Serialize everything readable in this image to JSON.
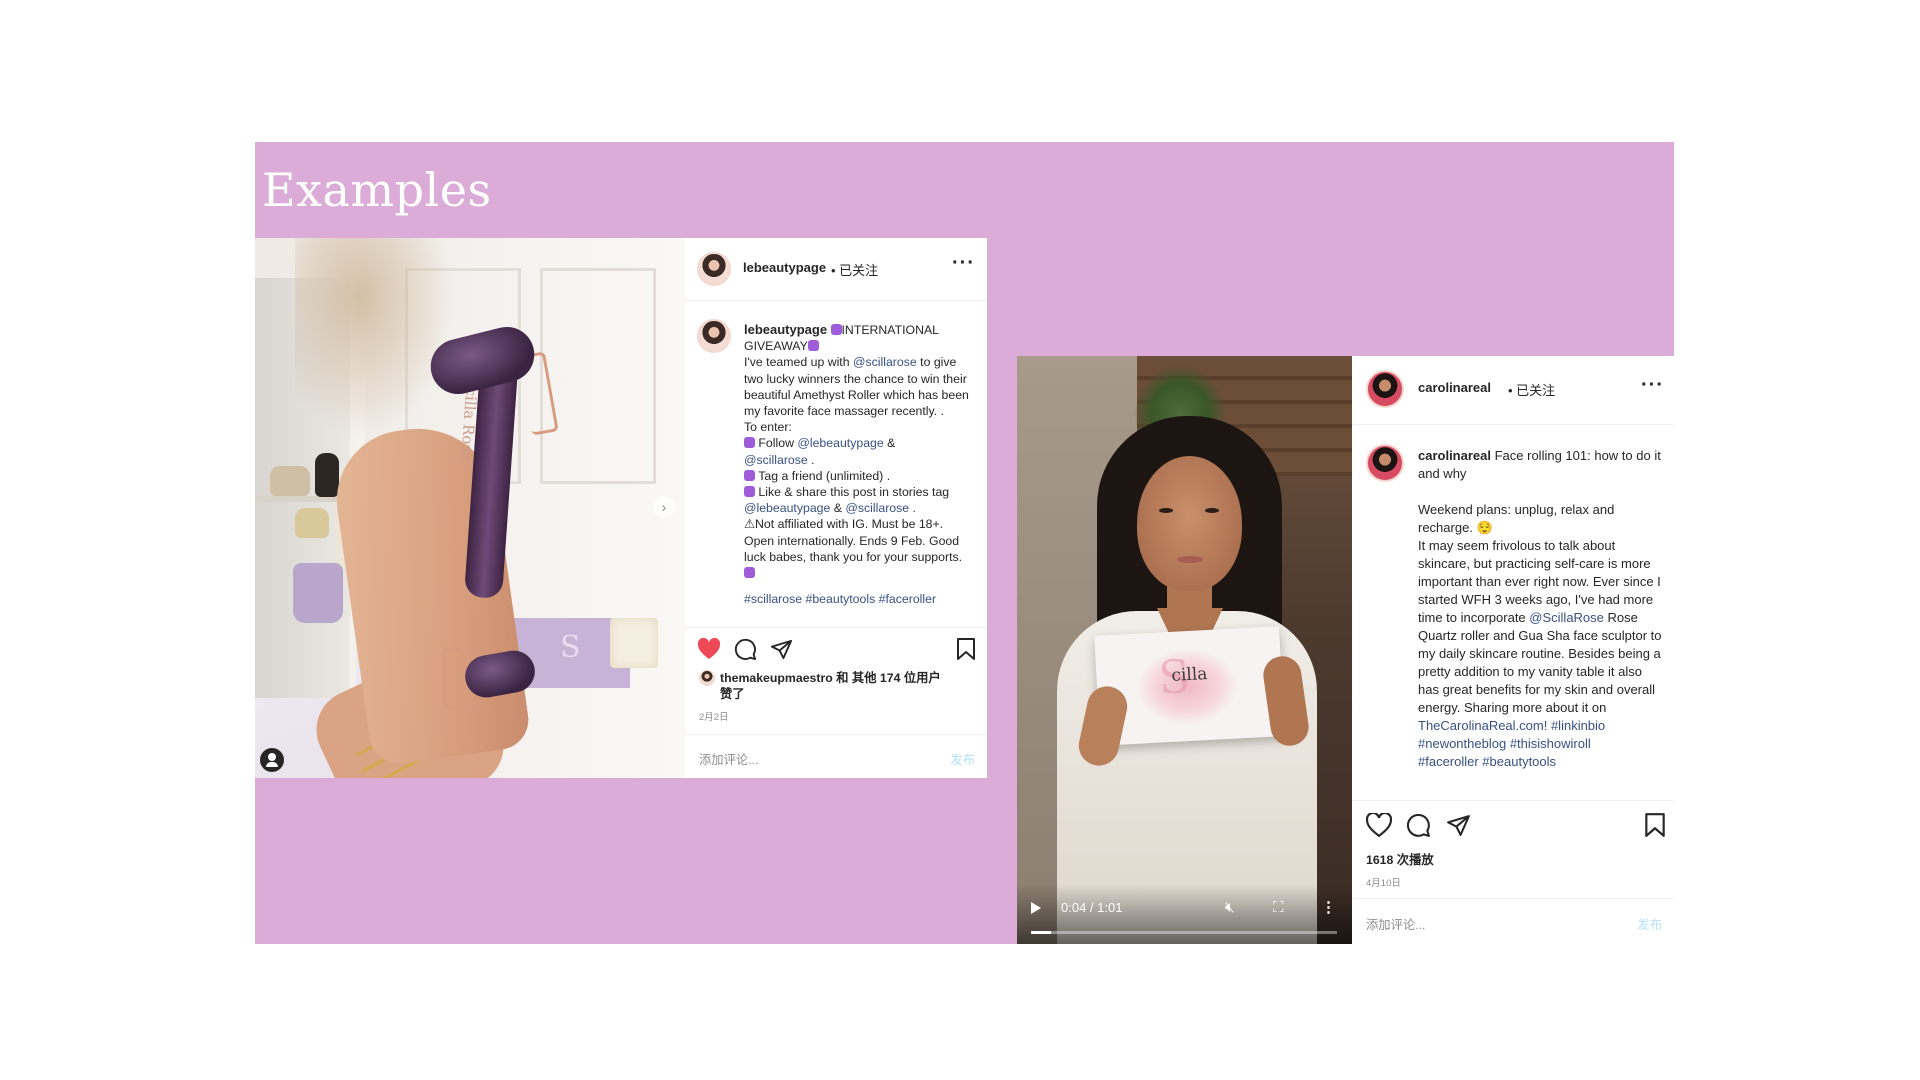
{
  "slide": {
    "title": "Examples",
    "bg_color": "#dbacd8"
  },
  "post1": {
    "image": {
      "roller_text": "Scilla Rose",
      "box_letter": "S"
    },
    "header": {
      "username": "lebeautypage",
      "follow_status": "• 已关注",
      "more_icon": "more-dots-icon"
    },
    "caption": {
      "username": "lebeautypage",
      "line1": "INTERNATIONAL",
      "line2": "GIVEAWAY",
      "p1_a": "I've teamed up with ",
      "p1_link": "@scillarose",
      "p1_b": " to give two lucky winners the chance to win their beautiful Amethyst Roller which has been my favorite face massager recently. .",
      "to_enter": "To enter:",
      "follow": "Follow ",
      "follow_link1": "@lebeautypage",
      "amp": " &",
      "follow_link2": "@scillarose",
      "dot": " .",
      "tag": "Tag a friend (unlimited) .",
      "share": "Like & share this post in stories tag ",
      "share_link1": "@lebeautypage",
      "share_amp": " & ",
      "share_link2": "@scillarose",
      "share_dot": " .",
      "disclaimer": "⚠Not affiliated with IG. Must be 18+. Open internationally. Ends 9 Feb. Good luck babes, thank you for your supports.",
      "hashtags": "#scillarose #beautytools #faceroller"
    },
    "likes": "themakeupmaestro 和 其他 174 位用户",
    "likes_suffix": "赞了",
    "date": "2月2日",
    "comment_placeholder": "添加评论...",
    "post_button": "发布"
  },
  "post2": {
    "video": {
      "time": "0:04 / 1:01",
      "box_logo": "cilla",
      "box_letter": "S",
      "progress": 0.066
    },
    "header": {
      "username": "carolinareal",
      "follow_status": "• 已关注"
    },
    "caption": {
      "username": "carolinareal",
      "intro": " Face rolling 101: how to do it and why",
      "weekend": "Weekend plans: unplug, relax and recharge. 😌",
      "body_a": "It may seem frivolous to talk about skincare, but practicing self-care is more important than ever right now. Ever since I started WFH 3 weeks ago, I've had more time to incorporate ",
      "body_link": "@ScillaRose",
      "body_b": " Rose Quartz roller and Gua Sha face sculptor to my daily skincare routine. Besides being a pretty addition to my vanity table it also has great benefits for my skin and overall energy. Sharing more about it on",
      "site_link": "TheCarolinaReal.com!",
      "tag1": " #linkinbio",
      "tag2": "#newontheblog",
      "tag3": " #thisishowiroll",
      "tag4": "#faceroller #beautytools"
    },
    "views": "1618 次播放",
    "date": "4月10日",
    "comment_placeholder": "添加评论...",
    "post_button": "发布"
  },
  "colors": {
    "link": "#385185",
    "heart_red": "#ed4956",
    "post_button": "#b2dffc"
  }
}
